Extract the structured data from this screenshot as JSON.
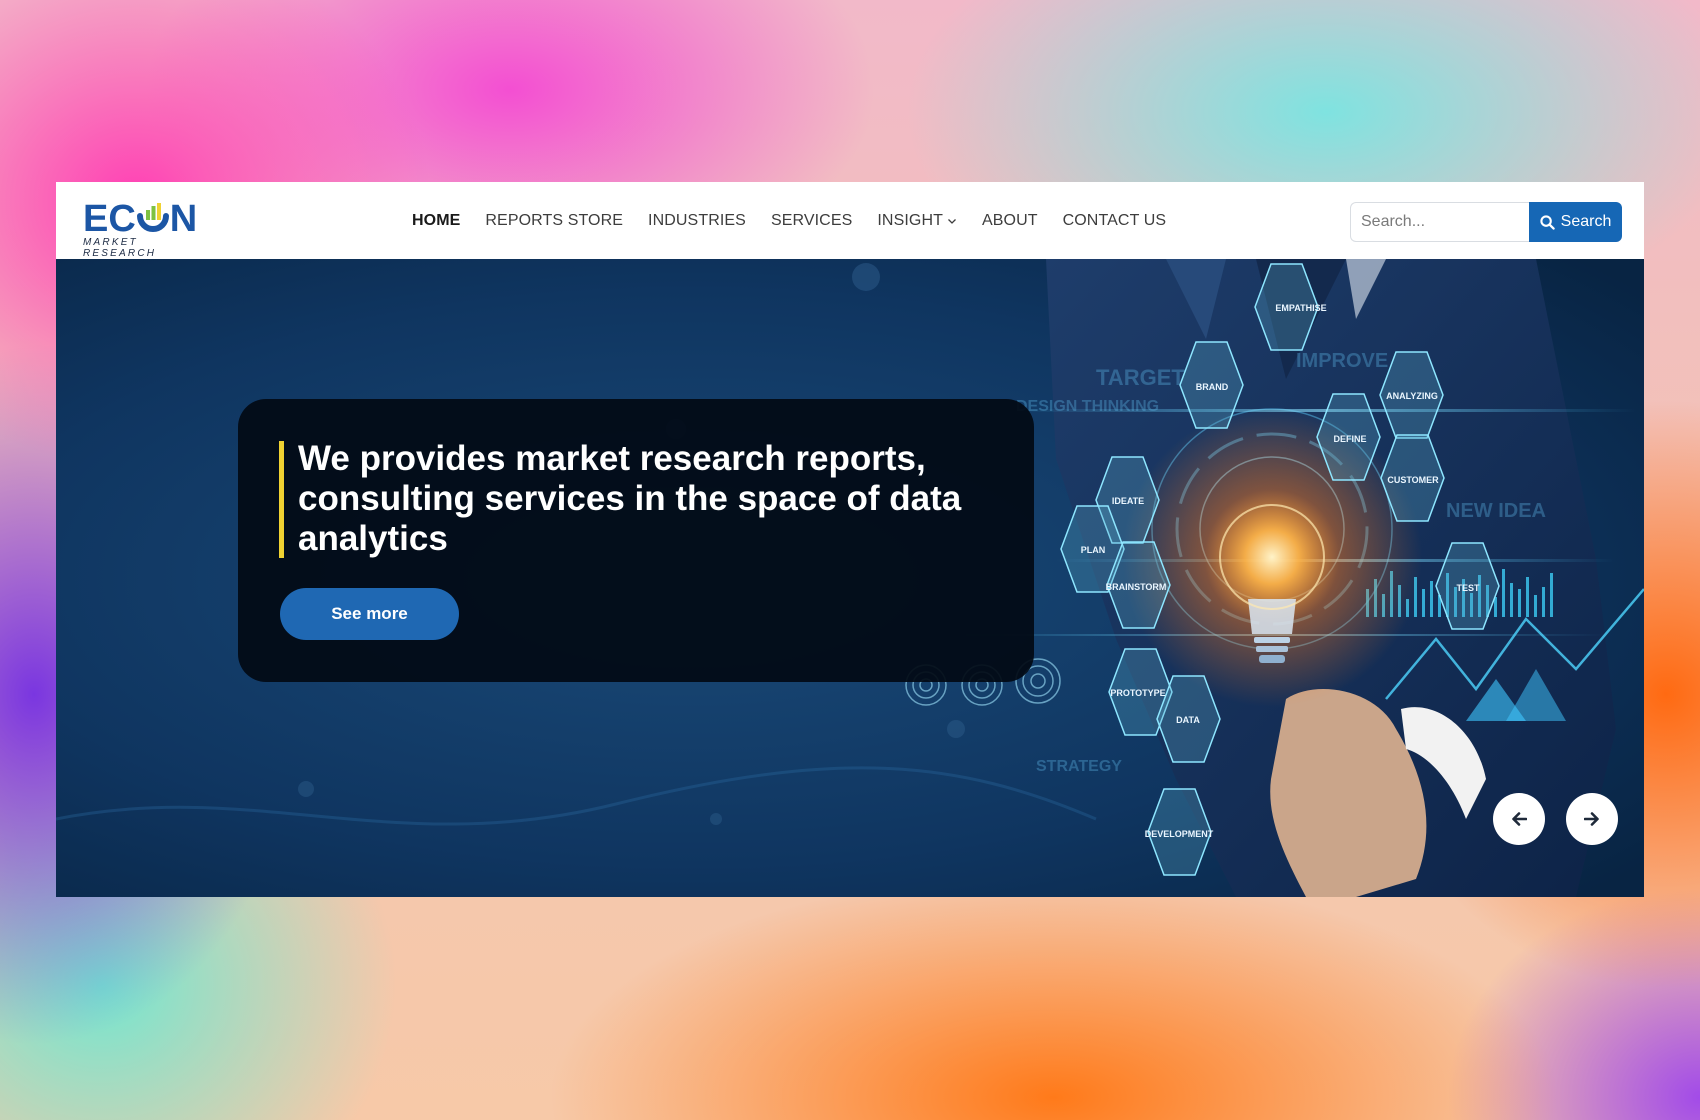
{
  "brand": {
    "logo_text_left": "EC",
    "logo_text_right": "N",
    "logo_subtitle": "MARKET RESEARCH",
    "primary_color": "#1c56a5",
    "accent_yellow": "#f0d232",
    "accent_green": "#7ec242"
  },
  "nav": {
    "items": [
      {
        "label": "HOME",
        "active": true
      },
      {
        "label": "REPORTS STORE",
        "active": false
      },
      {
        "label": "INDUSTRIES",
        "active": false
      },
      {
        "label": "SERVICES",
        "active": false
      },
      {
        "label": "INSIGHT",
        "active": false,
        "has_dropdown": true
      },
      {
        "label": "ABOUT",
        "active": false
      },
      {
        "label": "CONTACT US",
        "active": false
      }
    ]
  },
  "search": {
    "placeholder": "Search...",
    "button_label": "Search",
    "button_color": "#1667b5"
  },
  "hero": {
    "headline": "We provides market research reports, consulting services in the space of data analytics",
    "cta_label": "See more",
    "cta_color": "#1f68b3",
    "image_labels": [
      "EMPATHISE",
      "BRAND",
      "ANALYZING",
      "DEFINE",
      "CUSTOMER",
      "IDEATE",
      "PLAN",
      "BRAINSTORM",
      "TEST",
      "PROTOTYPE",
      "DATA",
      "DEVELOPMENT",
      "TARGET",
      "IMPROVE",
      "DESIGN THINKING",
      "NEW IDEA",
      "STRATEGY"
    ],
    "prev_icon": "arrow-left-icon",
    "next_icon": "arrow-right-icon"
  }
}
